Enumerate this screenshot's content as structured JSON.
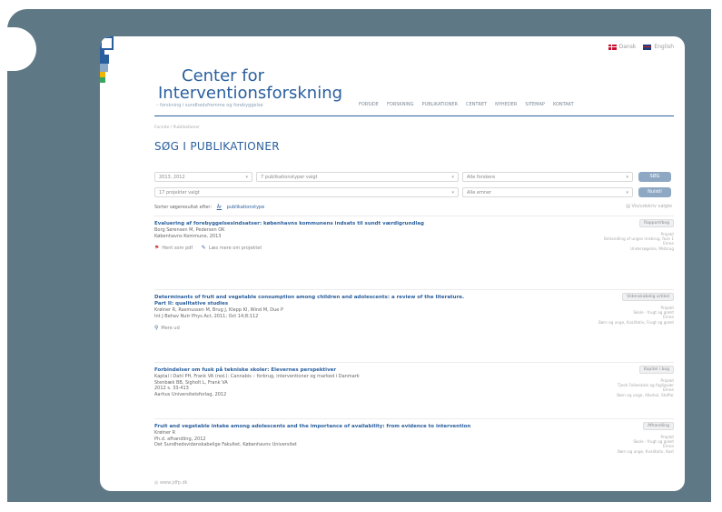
{
  "lang": {
    "danish": "Dansk",
    "english": "English"
  },
  "logo": {
    "line1": "Center for",
    "line2": "Interventionsforskning",
    "tagline": "– forskning i sundhedsfremme og forebyggelse"
  },
  "nav": [
    "FORSIDE",
    "FORSKNING",
    "PUBLIKATIONER",
    "CENTRET",
    "NYHEDER",
    "SITEMAP",
    "KONTAKT"
  ],
  "breadcrumb": "Forside / Publikationer",
  "page_title": "SØG I PUBLIKATIONER",
  "filters": {
    "years": "2013, 2012",
    "pubtype": "7 publikationstyper valgt",
    "forskere": "Alle forskere",
    "projekter": "17 projekter valgt",
    "emner": "Alle emner",
    "search_label": "SØG",
    "reset_label": "Nulstil"
  },
  "sort": {
    "label": "Sorter søgeresultat efter:",
    "by_year": "År",
    "by_type": "publikationstype",
    "results_link": "Vis/udskriv valgte"
  },
  "items": [
    {
      "title": "Evaluering af forebyggelsesindsatser: københavns kommunens indsats til sundt værdigrundlag",
      "authors": "Borg Sørensen M, Pedersen OK",
      "source": "Københavns Kommune, 2013",
      "badge": "Rapport/bog",
      "meta1": "Projekt",
      "meta1v": "Behandling af unges misbrug, fase 1",
      "meta2": "Emne",
      "meta2v": "Undersøgelse, Misbrug",
      "action1": "Hent som pdf",
      "action2": "Læs mere om projektet"
    },
    {
      "title": "Determinants of fruit and vegetable consumption among children and adolescents: a review of the literature. Part II: qualitative studies",
      "authors": "Krølner R, Rasmussen M, Brug J, Klepp KI, Wind M, Due P",
      "source": "Int J Behav Nutr Phys Act, 2011; Oct 14;8:112",
      "badge": "Videnskabelig artikel",
      "meta1": "Projekt",
      "meta1v": "Skole - frugt og grønt",
      "meta2": "Emne",
      "meta2v": "Børn og unge, Kvalitativ, Frugt og grønt",
      "action1": "Mere ud",
      "action2": ""
    },
    {
      "title": "Forbindelser om fusk på tekniske skoler: Elevernes perspektiver",
      "authors": "Kaptal i Dahl PH, Frank VA (red.): Cannabis – forbrug, interventioner og marked i Danmark",
      "source": "Stenbæk BB, Sigholt L, Frank VA",
      "source2": "2012 s. 33-413",
      "source3": "Aarhus Universitetsforlag, 2012",
      "badge": "Kapitel i bog",
      "meta1": "Projekt",
      "meta1v": "Tjeek Folkeskole og fagligvær",
      "meta2": "Emne",
      "meta2v": "Børn og unge, Alkohol, Stoffer"
    },
    {
      "title": "Fruit and vegetable intake among adolescents and the importance of availability: from evidence to intervention",
      "authors": "Krølner R",
      "source": "Ph.d. afhandling, 2012",
      "source2": "Det Sundhedsvidenskabelige Fakultet, Københavns Universitet",
      "badge": "Afhandling",
      "meta1": "Projekt",
      "meta1v": "Skole - frugt og grønt",
      "meta2": "Emne",
      "meta2v": "Børn og unge, Kvalitativ, Kost"
    }
  ],
  "footer_link": "www.jdfp.dk",
  "colors": {
    "frame": "#5f7886",
    "brand": "#2a5f9e",
    "button": "#8ea8c4"
  }
}
